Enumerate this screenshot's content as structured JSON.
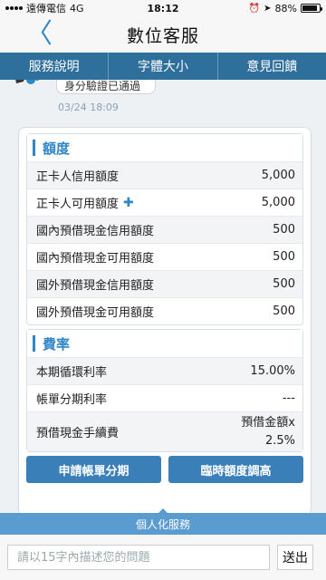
{
  "status": {
    "carrier": "遠傳電信",
    "network": "4G",
    "time": "18:12",
    "battery": "88%",
    "battery_level": 0.88
  },
  "nav": {
    "title": "數位客服",
    "back_icon": "chevron-left-icon"
  },
  "tabs": [
    {
      "label": "服務說明"
    },
    {
      "label": "字體大小"
    },
    {
      "label": "意見回饋"
    }
  ],
  "chat": {
    "prev_message": "身分驗證已通過",
    "prev_time": "03/24 18:09"
  },
  "quota": {
    "title": "額度",
    "rows": [
      {
        "label": "正卡人信用額度",
        "value": "5,000"
      },
      {
        "label": "正卡人可用額度",
        "value": "5,000",
        "has_plus": true
      },
      {
        "label": "國內預借現金信用額度",
        "value": "500"
      },
      {
        "label": "國內預借現金可用額度",
        "value": "500"
      },
      {
        "label": "國外預借現金信用額度",
        "value": "500"
      },
      {
        "label": "國外預借現金可用額度",
        "value": "500"
      }
    ]
  },
  "rates": {
    "title": "費率",
    "rows": [
      {
        "label": "本期循環利率",
        "value": "15.00%"
      },
      {
        "label": "帳單分期利率",
        "value": "---"
      },
      {
        "label": "預借現金手續費",
        "value": "預借金額x",
        "value2": "2.5%"
      }
    ]
  },
  "buttons": {
    "installment": "申請帳單分期",
    "temp_limit": "臨時額度調高"
  },
  "service_bar": "個人化服務",
  "input": {
    "placeholder": "請以15字內描述您的問題",
    "send": "送出"
  },
  "colors": {
    "accent": "#2f86c8",
    "tab_bar": "#2f6f9c",
    "button": "#3b7fb8"
  }
}
